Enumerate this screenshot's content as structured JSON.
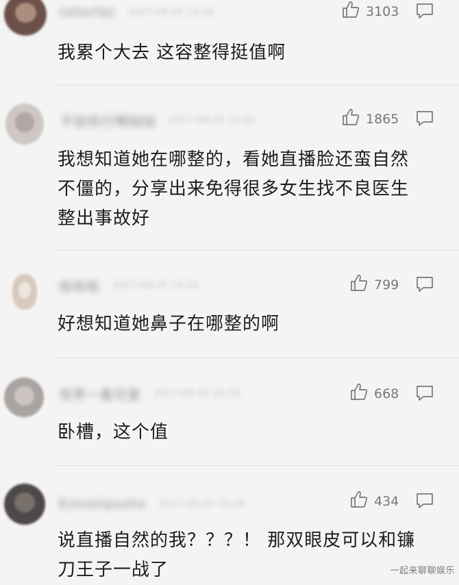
{
  "comments": [
    {
      "username": "(shorfa)",
      "time": "2017-09-25 15:26",
      "likes": "3103",
      "text_lines": [
        "我累个大去 这容整得挺值啊"
      ]
    },
    {
      "username": "不如你行啊哒哒",
      "time": "2017-09-25 15:43",
      "likes": "1865",
      "text_lines": [
        "我想知道她在哪整的，看她直播脸还蛮自然",
        "不僵的，分享出来免得很多女生找不良医生",
        "整出事故好"
      ]
    },
    {
      "username": "哈哈哈",
      "time": "2017-09-25 15:31",
      "likes": "799",
      "text_lines": [
        "好想知道她鼻子在哪整的啊"
      ]
    },
    {
      "username": "世界一看可爱",
      "time": "2017-09-25 15:33",
      "likes": "668",
      "text_lines": [
        "卧槽，这个值"
      ]
    },
    {
      "username": "Estrellaxsho",
      "time": "2017-09-25 15:28",
      "likes": "434",
      "text_lines": [
        "说直播自然的我？？？！ 那双眼皮可以和镰",
        "刀王子一战了"
      ]
    }
  ],
  "icons": {
    "like": "thumbs-up-icon",
    "reply": "comment-bubble-icon"
  },
  "avatar_colors": [
    "#6b5148",
    "#cfc7c3",
    "#d8c9bd",
    "#a9a4a2",
    "#4e4948"
  ],
  "watermark": "一起来聊聊娱乐"
}
